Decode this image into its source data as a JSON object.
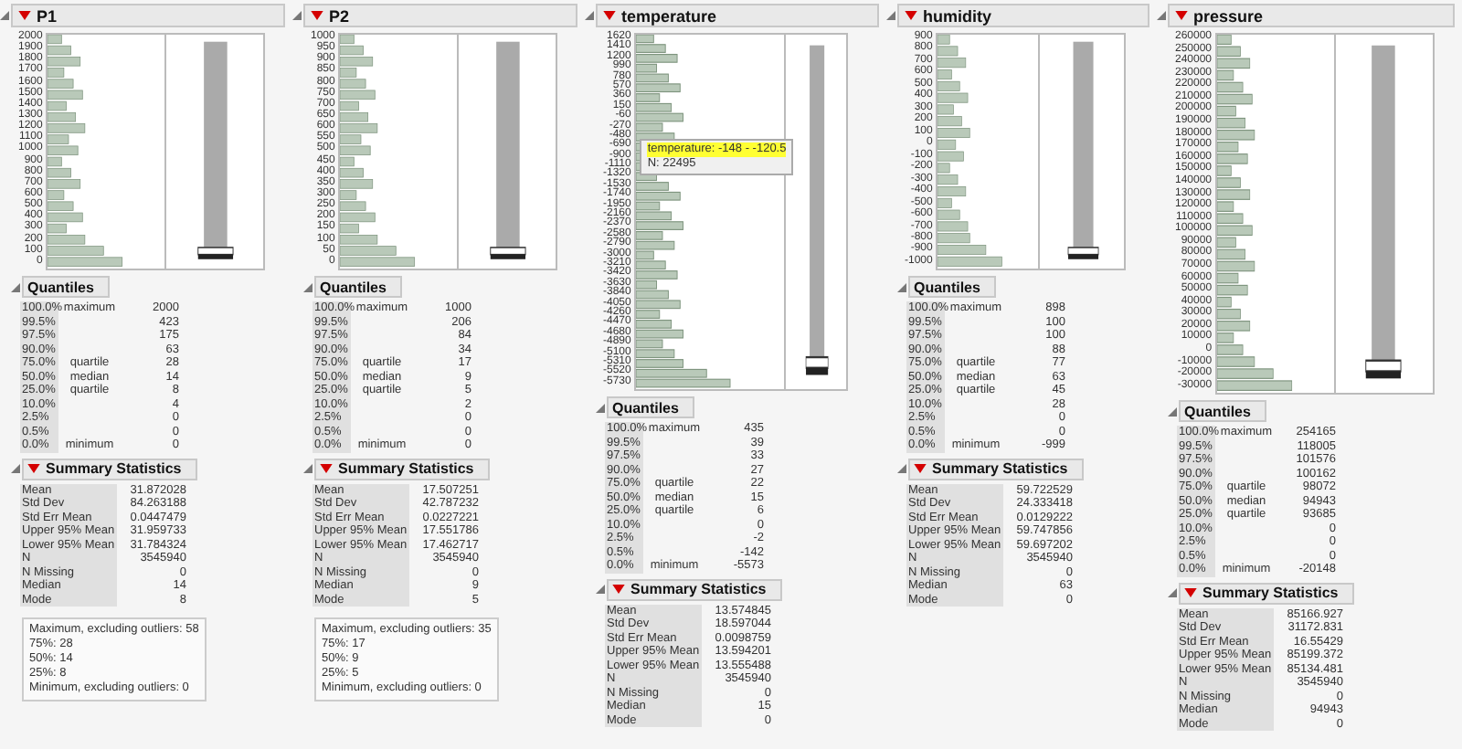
{
  "panels": [
    {
      "title": "P1",
      "ticks": [
        "2000",
        "1900",
        "1800",
        "1700",
        "1600",
        "1500",
        "1400",
        "1300",
        "1200",
        "1100",
        "1000",
        "900",
        "800",
        "700",
        "600",
        "500",
        "400",
        "300",
        "200",
        "100",
        "0"
      ],
      "quantiles": {
        "title": "Quantiles",
        "rows": [
          {
            "pct": "100.0%",
            "label": "maximum",
            "value": "2000"
          },
          {
            "pct": "99.5%",
            "value": "423"
          },
          {
            "pct": "97.5%",
            "value": "175"
          },
          {
            "pct": "90.0%",
            "value": "63"
          },
          {
            "pct": "75.0%",
            "label": "quartile",
            "value": "28"
          },
          {
            "pct": "50.0%",
            "label": "median",
            "value": "14"
          },
          {
            "pct": "25.0%",
            "label": "quartile",
            "value": "8"
          },
          {
            "pct": "10.0%",
            "value": "4"
          },
          {
            "pct": "2.5%",
            "value": "0"
          },
          {
            "pct": "0.5%",
            "value": "0"
          },
          {
            "pct": "0.0%",
            "label": "minimum",
            "value": "0"
          }
        ]
      },
      "summary": {
        "title": "Summary Statistics",
        "rows": [
          {
            "label": "Mean",
            "value": "31.872028"
          },
          {
            "label": "Std Dev",
            "value": "84.263188"
          },
          {
            "label": "Std Err Mean",
            "value": "0.0447479"
          },
          {
            "label": "Upper 95% Mean",
            "value": "31.959733"
          },
          {
            "label": "Lower 95% Mean",
            "value": "31.784324"
          },
          {
            "label": "N",
            "value": "3545940"
          },
          {
            "label": "N Missing",
            "value": "0"
          },
          {
            "label": "Median",
            "value": "14"
          },
          {
            "label": "Mode",
            "value": "8"
          }
        ]
      },
      "outlier_note": [
        "Maximum, excluding outliers: 58",
        "75%: 28",
        "50%: 14",
        "25%: 8",
        "Minimum, excluding outliers: 0"
      ]
    },
    {
      "title": "P2",
      "ticks": [
        "1000",
        "950",
        "900",
        "850",
        "800",
        "750",
        "700",
        "650",
        "600",
        "550",
        "500",
        "450",
        "400",
        "350",
        "300",
        "250",
        "200",
        "150",
        "100",
        "50",
        "0"
      ],
      "quantiles": {
        "title": "Quantiles",
        "rows": [
          {
            "pct": "100.0%",
            "label": "maximum",
            "value": "1000"
          },
          {
            "pct": "99.5%",
            "value": "206"
          },
          {
            "pct": "97.5%",
            "value": "84"
          },
          {
            "pct": "90.0%",
            "value": "34"
          },
          {
            "pct": "75.0%",
            "label": "quartile",
            "value": "17"
          },
          {
            "pct": "50.0%",
            "label": "median",
            "value": "9"
          },
          {
            "pct": "25.0%",
            "label": "quartile",
            "value": "5"
          },
          {
            "pct": "10.0%",
            "value": "2"
          },
          {
            "pct": "2.5%",
            "value": "0"
          },
          {
            "pct": "0.5%",
            "value": "0"
          },
          {
            "pct": "0.0%",
            "label": "minimum",
            "value": "0"
          }
        ]
      },
      "summary": {
        "title": "Summary Statistics",
        "rows": [
          {
            "label": "Mean",
            "value": "17.507251"
          },
          {
            "label": "Std Dev",
            "value": "42.787232"
          },
          {
            "label": "Std Err Mean",
            "value": "0.0227221"
          },
          {
            "label": "Upper 95% Mean",
            "value": "17.551786"
          },
          {
            "label": "Lower 95% Mean",
            "value": "17.462717"
          },
          {
            "label": "N",
            "value": "3545940"
          },
          {
            "label": "N Missing",
            "value": "0"
          },
          {
            "label": "Median",
            "value": "9"
          },
          {
            "label": "Mode",
            "value": "5"
          }
        ]
      },
      "outlier_note": [
        "Maximum, excluding outliers: 35",
        "75%: 17",
        "50%: 9",
        "25%: 5",
        "Minimum, excluding outliers: 0"
      ]
    },
    {
      "title": "temperature",
      "ticks": [
        "1620",
        "1410",
        "1200",
        "990",
        "780",
        "570",
        "360",
        "150",
        "-60",
        "-270",
        "-480",
        "-690",
        "-900",
        "-1110",
        "-1320",
        "-1530",
        "-1740",
        "-1950",
        "-2160",
        "-2370",
        "-2580",
        "-2790",
        "-3000",
        "-3210",
        "-3420",
        "-3630",
        "-3840",
        "-4050",
        "-4260",
        "-4470",
        "-4680",
        "-4890",
        "-5100",
        "-5310",
        "-5520",
        "-5730"
      ],
      "tooltip": [
        "temperature: -148 - -120.5",
        "N: 22495"
      ],
      "quantiles": {
        "title": "Quantiles",
        "rows": [
          {
            "pct": "100.0%",
            "label": "maximum",
            "value": "435"
          },
          {
            "pct": "99.5%",
            "value": "39"
          },
          {
            "pct": "97.5%",
            "value": "33"
          },
          {
            "pct": "90.0%",
            "value": "27"
          },
          {
            "pct": "75.0%",
            "label": "quartile",
            "value": "22"
          },
          {
            "pct": "50.0%",
            "label": "median",
            "value": "15"
          },
          {
            "pct": "25.0%",
            "label": "quartile",
            "value": "6"
          },
          {
            "pct": "10.0%",
            "value": "0"
          },
          {
            "pct": "2.5%",
            "value": "-2"
          },
          {
            "pct": "0.5%",
            "value": "-142"
          },
          {
            "pct": "0.0%",
            "label": "minimum",
            "value": "-5573"
          }
        ]
      },
      "summary": {
        "title": "Summary Statistics",
        "rows": [
          {
            "label": "Mean",
            "value": "13.574845"
          },
          {
            "label": "Std Dev",
            "value": "18.597044"
          },
          {
            "label": "Std Err Mean",
            "value": "0.0098759"
          },
          {
            "label": "Upper 95% Mean",
            "value": "13.594201"
          },
          {
            "label": "Lower 95% Mean",
            "value": "13.555488"
          },
          {
            "label": "N",
            "value": "3545940"
          },
          {
            "label": "N Missing",
            "value": "0"
          },
          {
            "label": "Median",
            "value": "15"
          },
          {
            "label": "Mode",
            "value": "0"
          }
        ]
      }
    },
    {
      "title": "humidity",
      "ticks": [
        "900",
        "800",
        "700",
        "600",
        "500",
        "400",
        "300",
        "200",
        "100",
        "0",
        "-100",
        "-200",
        "-300",
        "-400",
        "-500",
        "-600",
        "-700",
        "-800",
        "-900",
        "-1000"
      ],
      "quantiles": {
        "title": "Quantiles",
        "rows": [
          {
            "pct": "100.0%",
            "label": "maximum",
            "value": "898"
          },
          {
            "pct": "99.5%",
            "value": "100"
          },
          {
            "pct": "97.5%",
            "value": "100"
          },
          {
            "pct": "90.0%",
            "value": "88"
          },
          {
            "pct": "75.0%",
            "label": "quartile",
            "value": "77"
          },
          {
            "pct": "50.0%",
            "label": "median",
            "value": "63"
          },
          {
            "pct": "25.0%",
            "label": "quartile",
            "value": "45"
          },
          {
            "pct": "10.0%",
            "value": "28"
          },
          {
            "pct": "2.5%",
            "value": "0"
          },
          {
            "pct": "0.5%",
            "value": "0"
          },
          {
            "pct": "0.0%",
            "label": "minimum",
            "value": "-999"
          }
        ]
      },
      "summary": {
        "title": "Summary Statistics",
        "rows": [
          {
            "label": "Mean",
            "value": "59.722529"
          },
          {
            "label": "Std Dev",
            "value": "24.333418"
          },
          {
            "label": "Std Err Mean",
            "value": "0.0129222"
          },
          {
            "label": "Upper 95% Mean",
            "value": "59.747856"
          },
          {
            "label": "Lower 95% Mean",
            "value": "59.697202"
          },
          {
            "label": "N",
            "value": "3545940"
          },
          {
            "label": "N Missing",
            "value": "0"
          },
          {
            "label": "Median",
            "value": "63"
          },
          {
            "label": "Mode",
            "value": "0"
          }
        ]
      }
    },
    {
      "title": "pressure",
      "ticks": [
        "260000",
        "250000",
        "240000",
        "230000",
        "220000",
        "210000",
        "200000",
        "190000",
        "180000",
        "170000",
        "160000",
        "150000",
        "140000",
        "130000",
        "120000",
        "110000",
        "100000",
        "90000",
        "80000",
        "70000",
        "60000",
        "50000",
        "40000",
        "30000",
        "20000",
        "10000",
        "0",
        "-10000",
        "-20000",
        "-30000"
      ],
      "quantiles": {
        "title": "Quantiles",
        "rows": [
          {
            "pct": "100.0%",
            "label": "maximum",
            "value": "254165"
          },
          {
            "pct": "99.5%",
            "value": "118005"
          },
          {
            "pct": "97.5%",
            "value": "101576"
          },
          {
            "pct": "90.0%",
            "value": "100162"
          },
          {
            "pct": "75.0%",
            "label": "quartile",
            "value": "98072"
          },
          {
            "pct": "50.0%",
            "label": "median",
            "value": "94943"
          },
          {
            "pct": "25.0%",
            "label": "quartile",
            "value": "93685"
          },
          {
            "pct": "10.0%",
            "value": "0"
          },
          {
            "pct": "2.5%",
            "value": "0"
          },
          {
            "pct": "0.5%",
            "value": "0"
          },
          {
            "pct": "0.0%",
            "label": "minimum",
            "value": "-20148"
          }
        ]
      },
      "summary": {
        "title": "Summary Statistics",
        "rows": [
          {
            "label": "Mean",
            "value": "85166.927"
          },
          {
            "label": "Std Dev",
            "value": "31172.831"
          },
          {
            "label": "Std Err Mean",
            "value": "16.55429"
          },
          {
            "label": "Upper 95% Mean",
            "value": "85199.372"
          },
          {
            "label": "Lower 95% Mean",
            "value": "85134.481"
          },
          {
            "label": "N",
            "value": "3545940"
          },
          {
            "label": "N Missing",
            "value": "0"
          },
          {
            "label": "Median",
            "value": "94943"
          },
          {
            "label": "Mode",
            "value": "0"
          }
        ]
      }
    }
  ]
}
